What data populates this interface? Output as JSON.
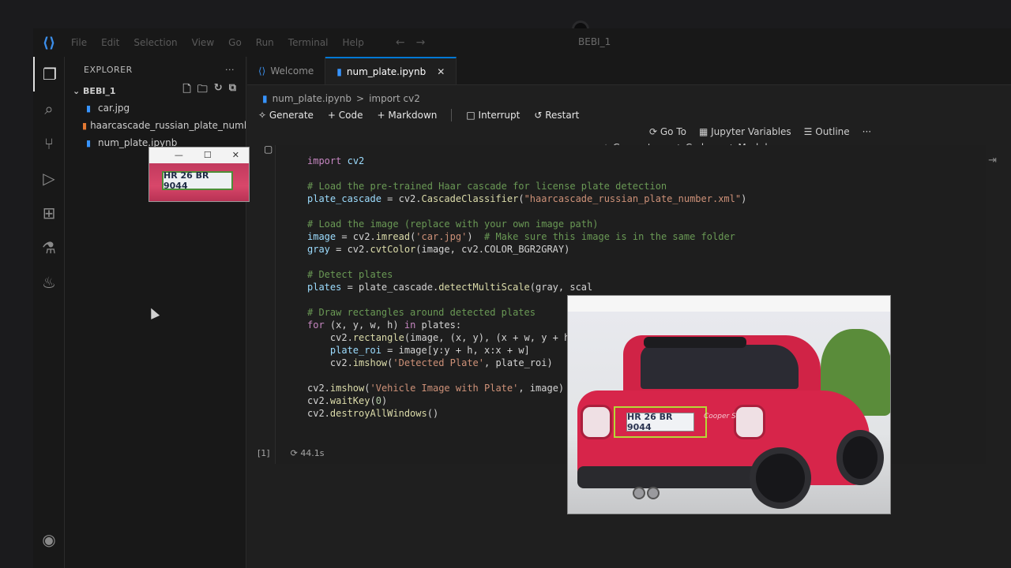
{
  "titlebar": {
    "menu": [
      "File",
      "Edit",
      "Selection",
      "View",
      "Go",
      "Run",
      "Terminal",
      "Help"
    ],
    "window_title": "BEBI_1"
  },
  "activity_icons": [
    "explorer-icon",
    "search-icon",
    "source-control-icon",
    "run-debug-icon",
    "extensions-icon",
    "testing-icon",
    "python-icon",
    "account-icon"
  ],
  "sidebar": {
    "title": "EXPLORER",
    "more": "···",
    "folder": "BEBI_1",
    "files": [
      {
        "name": "car.jpg",
        "icon": "image-file-icon",
        "color": "#3794ff"
      },
      {
        "name": "haarcascade_russian_plate_number.x...",
        "icon": "xml-file-icon",
        "color": "#e37933"
      },
      {
        "name": "num_plate.ipynb",
        "icon": "notebook-file-icon",
        "color": "#3794ff"
      }
    ]
  },
  "tabs": [
    {
      "label": "Welcome",
      "active": false
    },
    {
      "label": "num_plate.ipynb",
      "active": true,
      "close": "✕"
    }
  ],
  "breadcrumb": {
    "file": "num_plate.ipynb",
    "sep": ">",
    "symbol": "import cv2"
  },
  "toolbar": {
    "generate": "Generate",
    "code": "Code",
    "markdown": "Markdown",
    "interrupt": "Interrupt",
    "restart": "Restart"
  },
  "toolbar_right": {
    "goto": "Go To",
    "jupyter_vars": "Jupyter Variables",
    "outline": "Outline",
    "more": "···"
  },
  "cell_toolbar": {
    "generate": "Generate",
    "code": "Code",
    "markdown": "Markdown"
  },
  "cell": {
    "exec_count": "[1]",
    "duration": "44.1s"
  },
  "code_lines": [
    {
      "indent": "",
      "parts": [
        [
          "kw",
          "import"
        ],
        [
          "op",
          " "
        ],
        [
          "var",
          "cv2"
        ]
      ]
    },
    {
      "indent": "",
      "parts": []
    },
    {
      "indent": "",
      "parts": [
        [
          "cm",
          "# Load the pre-trained Haar cascade for license plate detection"
        ]
      ]
    },
    {
      "indent": "",
      "parts": [
        [
          "var",
          "plate_cascade"
        ],
        [
          "op",
          " = cv2."
        ],
        [
          "fn",
          "CascadeClassifier"
        ],
        [
          "op",
          "("
        ],
        [
          "str",
          "\"haarcascade_russian_plate_number.xml\""
        ],
        [
          "op",
          ")"
        ]
      ]
    },
    {
      "indent": "",
      "parts": []
    },
    {
      "indent": "",
      "parts": [
        [
          "cm",
          "# Load the image (replace with your own image path)"
        ]
      ]
    },
    {
      "indent": "",
      "parts": [
        [
          "var",
          "image"
        ],
        [
          "op",
          " = cv2."
        ],
        [
          "fn",
          "imread"
        ],
        [
          "op",
          "("
        ],
        [
          "str",
          "'car.jpg'"
        ],
        [
          "op",
          ")  "
        ],
        [
          "cm",
          "# Make sure this image is in the same folder"
        ]
      ]
    },
    {
      "indent": "",
      "parts": [
        [
          "var",
          "gray"
        ],
        [
          "op",
          " = cv2."
        ],
        [
          "fn",
          "cvtColor"
        ],
        [
          "op",
          "(image, cv2.COLOR_BGR2GRAY)"
        ]
      ]
    },
    {
      "indent": "",
      "parts": []
    },
    {
      "indent": "",
      "parts": [
        [
          "cm",
          "# Detect plates"
        ]
      ]
    },
    {
      "indent": "",
      "parts": [
        [
          "var",
          "plates"
        ],
        [
          "op",
          " = plate_cascade."
        ],
        [
          "fn",
          "detectMultiScale"
        ],
        [
          "op",
          "(gray, scal"
        ]
      ]
    },
    {
      "indent": "",
      "parts": []
    },
    {
      "indent": "",
      "parts": [
        [
          "cm",
          "# Draw rectangles around detected plates"
        ]
      ]
    },
    {
      "indent": "",
      "parts": [
        [
          "kw",
          "for"
        ],
        [
          "op",
          " (x, y, w, h) "
        ],
        [
          "kw",
          "in"
        ],
        [
          "op",
          " plates:"
        ]
      ]
    },
    {
      "indent": "    ",
      "parts": [
        [
          "op",
          "cv2."
        ],
        [
          "fn",
          "rectangle"
        ],
        [
          "op",
          "(image, (x, y), (x + w, y + h), ("
        ]
      ]
    },
    {
      "indent": "    ",
      "parts": [
        [
          "var",
          "plate_roi"
        ],
        [
          "op",
          " = image[y:y + h, x:x + w]"
        ]
      ]
    },
    {
      "indent": "    ",
      "parts": [
        [
          "op",
          "cv2."
        ],
        [
          "fn",
          "imshow"
        ],
        [
          "op",
          "("
        ],
        [
          "str",
          "'Detected Plate'"
        ],
        [
          "op",
          ", plate_roi)"
        ]
      ]
    },
    {
      "indent": "",
      "parts": []
    },
    {
      "indent": "",
      "parts": [
        [
          "op",
          "cv2."
        ],
        [
          "fn",
          "imshow"
        ],
        [
          "op",
          "("
        ],
        [
          "str",
          "'Vehicle Image with Plate'"
        ],
        [
          "op",
          ", image)"
        ]
      ]
    },
    {
      "indent": "",
      "parts": [
        [
          "op",
          "cv2."
        ],
        [
          "fn",
          "waitKey"
        ],
        [
          "op",
          "("
        ],
        [
          "num",
          "0"
        ],
        [
          "op",
          ")"
        ]
      ]
    },
    {
      "indent": "",
      "parts": [
        [
          "op",
          "cv2."
        ],
        [
          "fn",
          "destroyAllWindows"
        ],
        [
          "op",
          "()"
        ]
      ]
    }
  ],
  "plate_window": {
    "plate_text": "HR 26 BR 9044",
    "controls": [
      "—",
      "☐",
      "✕"
    ]
  },
  "vehicle_window": {
    "plate_text": "HR 26 BR 9044",
    "badge_text": "Cooper S"
  },
  "colors": {
    "accent": "#0078d4",
    "editor_bg": "#1f1f1f",
    "detection_box": "#b6d836",
    "car_red": "#d7254a"
  }
}
